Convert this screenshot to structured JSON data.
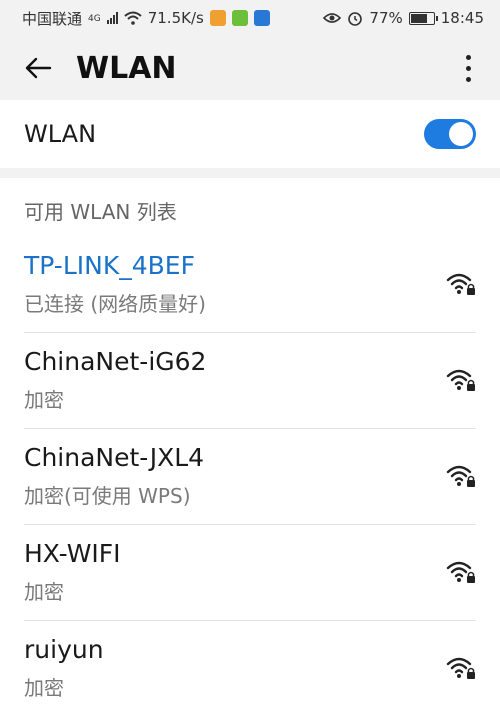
{
  "status_bar": {
    "carrier": "中国联通",
    "network_type": "4G",
    "speed": "71.5K/s",
    "battery": "77%",
    "battery_level": 0.77,
    "time": "18:45"
  },
  "app_bar": {
    "title": "WLAN"
  },
  "wlan_toggle": {
    "label": "WLAN",
    "enabled": true
  },
  "networks_section": {
    "title": "可用 WLAN 列表",
    "items": [
      {
        "name": "TP-LINK_4BEF",
        "status": "已连接 (网络质量好)",
        "connected": true
      },
      {
        "name": "ChinaNet-iG62",
        "status": "加密",
        "connected": false
      },
      {
        "name": "ChinaNet-JXL4",
        "status": "加密(可使用 WPS)",
        "connected": false
      },
      {
        "name": "HX-WIFI",
        "status": "加密",
        "connected": false
      },
      {
        "name": "ruiyun",
        "status": "加密",
        "connected": false
      }
    ]
  },
  "colors": {
    "accent": "#1e7be0",
    "connected_text": "#1a73c8"
  }
}
